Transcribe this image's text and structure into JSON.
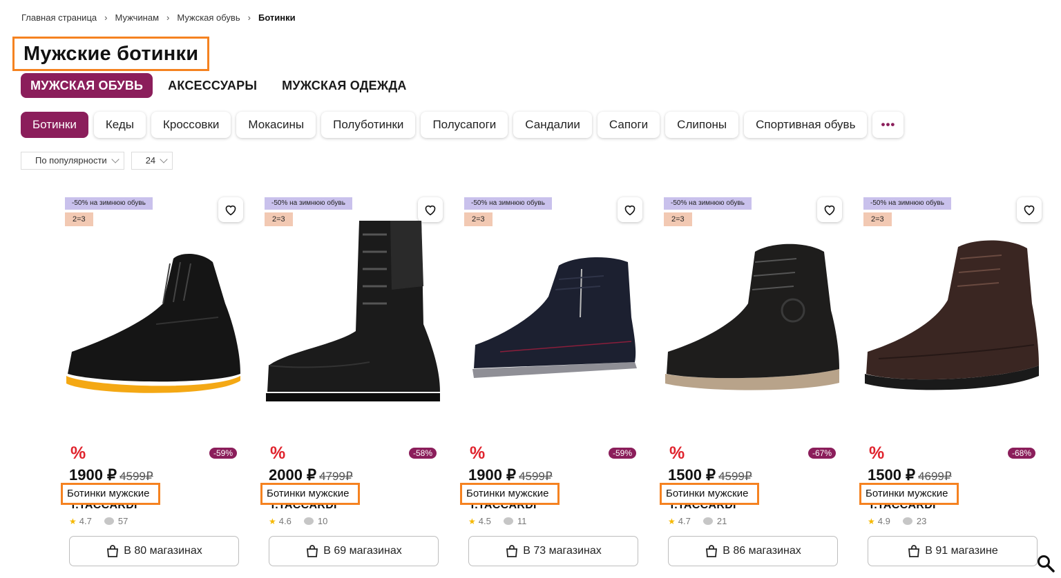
{
  "breadcrumb": [
    "Главная страница",
    "Мужчинам",
    "Мужская обувь",
    "Ботинки"
  ],
  "page_title": "Мужские ботинки",
  "category_tabs": [
    {
      "label": "МУЖСКАЯ ОБУВЬ",
      "active": true
    },
    {
      "label": "АКСЕССУАРЫ",
      "active": false
    },
    {
      "label": "МУЖСКАЯ ОДЕЖДА",
      "active": false
    }
  ],
  "chips": [
    {
      "label": "Ботинки",
      "active": true
    },
    {
      "label": "Кеды"
    },
    {
      "label": "Кроссовки"
    },
    {
      "label": "Мокасины"
    },
    {
      "label": "Полуботинки"
    },
    {
      "label": "Полусапоги"
    },
    {
      "label": "Сандалии"
    },
    {
      "label": "Сапоги"
    },
    {
      "label": "Слипоны"
    },
    {
      "label": "Спортивная обувь"
    }
  ],
  "more_chip": "•••",
  "sort": {
    "label": "По популярности",
    "per_page": "24"
  },
  "colors": {
    "accent": "#8b1e5b",
    "highlight": "#f58220",
    "sale": "#e0232d",
    "promo_bg": "#c9c1ec",
    "bundle_bg": "#f2c9b3"
  },
  "products": [
    {
      "promo": "-50% на зимнюю обувь",
      "bundle": "2=3",
      "discount": "-59%",
      "price": "1900 ₽",
      "old_price": "4599₽",
      "name": "Ботинки мужские",
      "brand": "T.TACCARDI",
      "rating": "4.7",
      "reviews": "57",
      "stores": "В 80 магазинах",
      "sale_mark": "%"
    },
    {
      "promo": "-50% на зимнюю обувь",
      "bundle": "2=3",
      "discount": "-58%",
      "price": "2000 ₽",
      "old_price": "4799₽",
      "name": "Ботинки мужские",
      "brand": "T.TACCARDI",
      "rating": "4.6",
      "reviews": "10",
      "stores": "В 69 магазинах",
      "sale_mark": "%"
    },
    {
      "promo": "-50% на зимнюю обувь",
      "bundle": "2=3",
      "discount": "-59%",
      "price": "1900 ₽",
      "old_price": "4599₽",
      "name": "Ботинки мужские",
      "brand": "T.TACCARDI",
      "rating": "4.5",
      "reviews": "11",
      "stores": "В 73 магазинах",
      "sale_mark": "%"
    },
    {
      "promo": "-50% на зимнюю обувь",
      "bundle": "2=3",
      "discount": "-67%",
      "price": "1500 ₽",
      "old_price": "4599₽",
      "name": "Ботинки мужские",
      "brand": "T.TACCARDI",
      "rating": "4.7",
      "reviews": "21",
      "stores": "В 86 магазинах",
      "sale_mark": "%"
    },
    {
      "promo": "-50% на зимнюю обувь",
      "bundle": "2=3",
      "discount": "-68%",
      "price": "1500 ₽",
      "old_price": "4699₽",
      "name": "Ботинки мужские",
      "brand": "T.TACCARDI",
      "rating": "4.9",
      "reviews": "23",
      "stores": "В 91 магазине",
      "sale_mark": "%"
    }
  ],
  "icons": {
    "favorite": "heart-icon",
    "store": "shopping-bag-icon",
    "search": "search-icon",
    "rating": "star-icon",
    "reviews": "comment-icon"
  }
}
